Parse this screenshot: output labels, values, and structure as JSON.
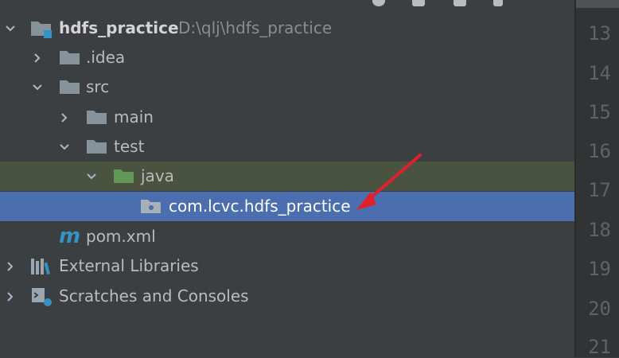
{
  "project": {
    "name": "hdfs_practice",
    "path": "D:\\qlj\\hdfs_practice"
  },
  "tree": {
    "idea": ".idea",
    "src": "src",
    "main": "main",
    "test": "test",
    "java": "java",
    "package": "com.lcvc.hdfs_practice",
    "pom": "pom.xml",
    "external_libraries": "External Libraries",
    "scratches": "Scratches and Consoles"
  },
  "gutter": {
    "line_numbers": [
      "13",
      "14",
      "15",
      "16",
      "17",
      "18",
      "19",
      "20",
      "21"
    ]
  },
  "colors": {
    "panel_bg": "#3c3f41",
    "selection": "#4b6eaf",
    "java_row_highlight": "#4a5240",
    "annotation_arrow": "#e0202a",
    "source_folder_icon": "#629755",
    "maven_icon": "#3592c4"
  },
  "icons": {
    "expanded": "chevron-down-icon",
    "collapsed": "chevron-right-icon",
    "module": "module-folder-icon",
    "folder": "folder-icon",
    "source_root": "source-folder-icon",
    "package": "package-icon",
    "maven": "maven-icon",
    "libraries": "libraries-icon",
    "scratches": "scratches-icon"
  }
}
